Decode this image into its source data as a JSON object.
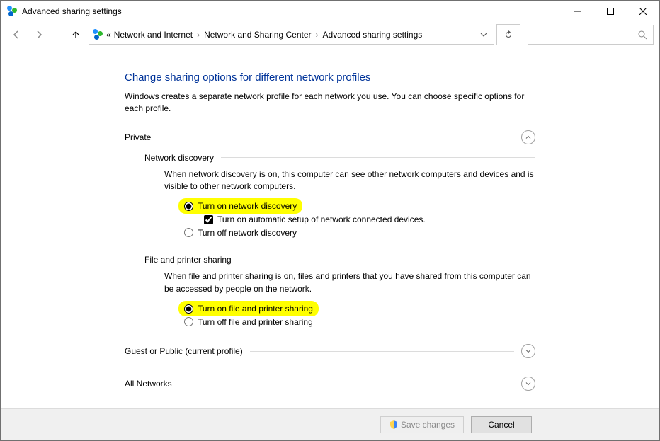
{
  "window": {
    "title": "Advanced sharing settings"
  },
  "breadcrumb": {
    "prefix": "«",
    "items": [
      "Network and Internet",
      "Network and Sharing Center",
      "Advanced sharing settings"
    ]
  },
  "page": {
    "heading": "Change sharing options for different network profiles",
    "subtext": "Windows creates a separate network profile for each network you use. You can choose specific options for each profile."
  },
  "private": {
    "label": "Private",
    "network_discovery": {
      "label": "Network discovery",
      "desc": "When network discovery is on, this computer can see other network computers and devices and is visible to other network computers.",
      "on": "Turn on network discovery",
      "auto": "Turn on automatic setup of network connected devices.",
      "off": "Turn off network discovery"
    },
    "file_printer": {
      "label": "File and printer sharing",
      "desc": "When file and printer sharing is on, files and printers that you have shared from this computer can be accessed by people on the network.",
      "on": "Turn on file and printer sharing",
      "off": "Turn off file and printer sharing"
    }
  },
  "guest": {
    "label": "Guest or Public (current profile)"
  },
  "all": {
    "label": "All Networks"
  },
  "buttons": {
    "save": "Save changes",
    "cancel": "Cancel"
  }
}
